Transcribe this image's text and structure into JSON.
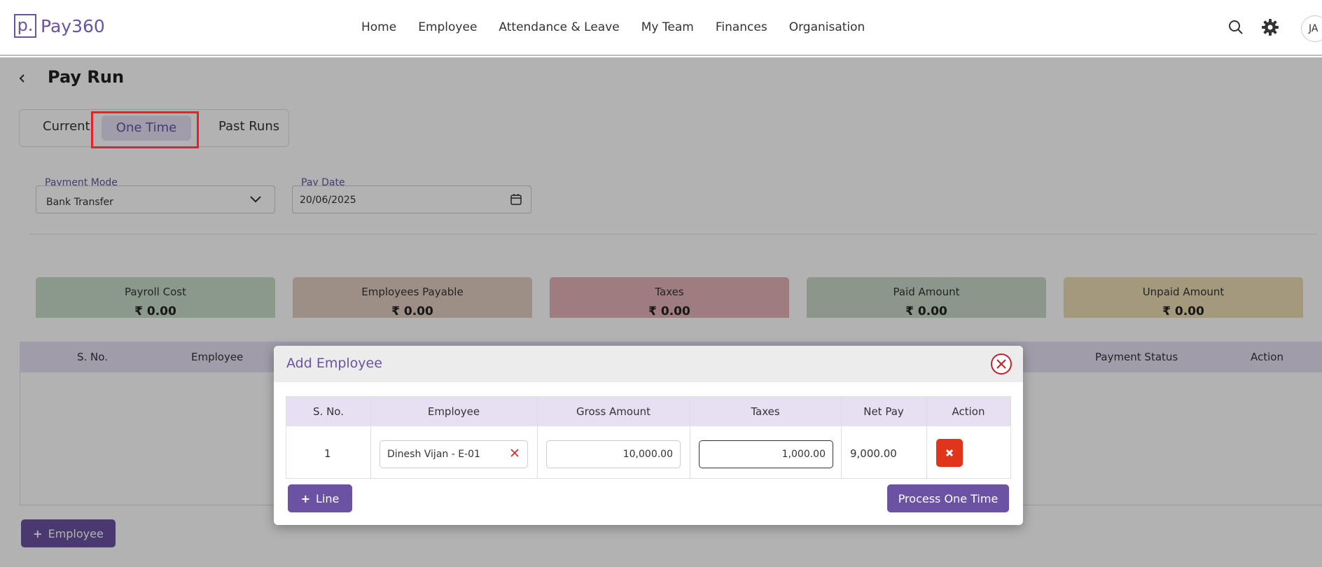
{
  "brand": {
    "logo_mark": "p.",
    "name": "Pay360"
  },
  "nav": [
    "Home",
    "Employee",
    "Attendance & Leave",
    "My Team",
    "Finances",
    "Organisation"
  ],
  "header_icons": {
    "search": "search-icon",
    "settings": "gear-icon"
  },
  "user": {
    "initials": "JA"
  },
  "page": {
    "title": "Pay Run"
  },
  "tabs": [
    "Current",
    "One Time",
    "Past Runs"
  ],
  "active_tab": "One Time",
  "filters": {
    "payment_mode": {
      "label": "Payment Mode",
      "value": "Bank Transfer"
    },
    "pay_date": {
      "label": "Pay Date",
      "value": "20/06/2025"
    }
  },
  "summary": [
    {
      "label": "Payroll Cost",
      "value": "₹ 0.00",
      "color": "#c8dcc8"
    },
    {
      "label": "Employees Payable",
      "value": "₹ 0.00",
      "color": "#e2cdc0"
    },
    {
      "label": "Taxes",
      "value": "₹ 0.00",
      "color": "#e4b2b8"
    },
    {
      "label": "Paid Amount",
      "value": "₹ 0.00",
      "color": "#c6d8c6"
    },
    {
      "label": "Unpaid Amount",
      "value": "₹ 0.00",
      "color": "#ecdcb4"
    }
  ],
  "list_table": {
    "columns": [
      "S. No.",
      "Employee",
      "Payment Status",
      "Action"
    ]
  },
  "add_employee_button": "Employee",
  "modal": {
    "title": "Add Employee",
    "columns": [
      "S. No.",
      "Employee",
      "Gross Amount",
      "Taxes",
      "Net Pay",
      "Action"
    ],
    "rows": [
      {
        "sno": "1",
        "employee": "Dinesh Vijan - E-01",
        "gross": "10,000.00",
        "taxes": "1,000.00",
        "net": "9,000.00"
      }
    ],
    "line_button": "Line",
    "process_button": "Process One Time"
  },
  "colors": {
    "accent": "#6b52a3",
    "danger": "#e0341b",
    "highlight": "#e8202c"
  }
}
